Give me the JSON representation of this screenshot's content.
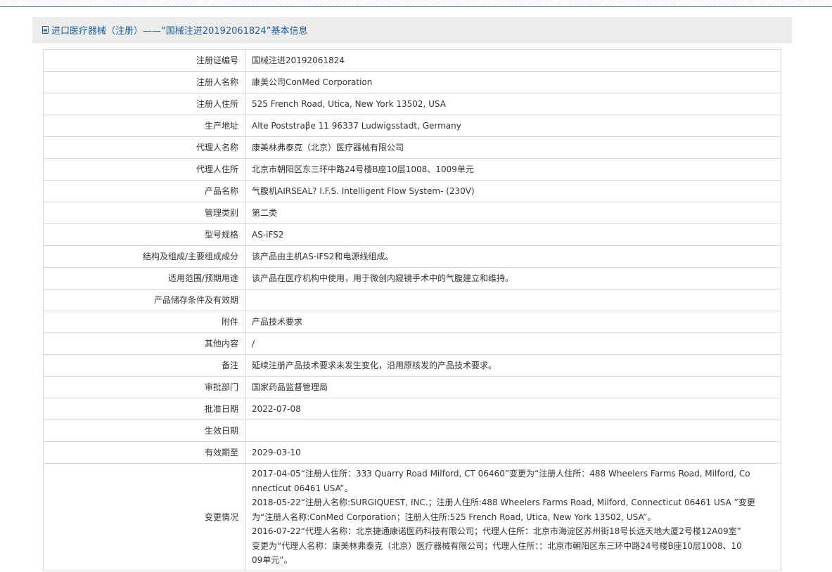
{
  "header": {
    "title": "进口医疗器械（注册）——“国械注进20192061824”基本信息"
  },
  "rows": [
    {
      "label": "注册证编号",
      "value": "国械注进20192061824"
    },
    {
      "label": "注册人名称",
      "value": "康美公司ConMed Corporation"
    },
    {
      "label": "注册人住所",
      "value": "525 French Road, Utica, New York 13502, USA"
    },
    {
      "label": "生产地址",
      "value": "Alte Poststraβe 11 96337 Ludwigsstadt, Germany"
    },
    {
      "label": "代理人名称",
      "value": "康美林弗泰克（北京）医疗器械有限公司"
    },
    {
      "label": "代理人住所",
      "value": "北京市朝阳区东三环中路24号楼B座10层1008、1009单元"
    },
    {
      "label": "产品名称",
      "value": "气腹机AIRSEAL? I.F.S. Intelligent Flow System- (230V)"
    },
    {
      "label": "管理类别",
      "value": "第二类"
    },
    {
      "label": "型号规格",
      "value": "AS-iFS2"
    },
    {
      "label": "结构及组成/主要组成成分",
      "value": "该产品由主机AS-iFS2和电源线组成。"
    },
    {
      "label": "适用范围/预期用途",
      "value": "该产品在医疗机构中使用，用于微创内窥镜手术中的气腹建立和维持。"
    },
    {
      "label": "产品储存条件及有效期",
      "value": ""
    },
    {
      "label": "附件",
      "value": "产品技术要求"
    },
    {
      "label": "其他内容",
      "value": "/"
    },
    {
      "label": "备注",
      "value": "延续注册产品技术要求未发生变化，沿用原核发的产品技术要求。"
    },
    {
      "label": "审批部门",
      "value": "国家药品监督管理局"
    },
    {
      "label": "批准日期",
      "value": "2022-07-08"
    },
    {
      "label": "生效日期",
      "value": ""
    },
    {
      "label": "有效期至",
      "value": "2029-03-10"
    }
  ],
  "change": {
    "label": "变更情况",
    "lines": [
      "2017-04-05“注册人住所：333 Quarry Road Milford, CT 06460”变更为“注册人住所：488 Wheelers Farms Road, Milford, Co",
      "nnecticut 06461 USA”。",
      "2018-05-22“注册人名称:SURGIQUEST, INC.；注册人住所:488 Wheelers Farms Road, Milford, Connecticut 06461 USA ”变更",
      "为“注册人名称:ConMed Corporation；注册人住所:525 French Road, Utica, New York 13502, USA”。",
      "2016-07-22“代理人名称：北京捷通康诺医药科技有限公司；代理人住所：北京市海淀区苏州街18号长远天地大厦2号楼12A09室”",
      "变更为“代理人名称：康美林弗泰克（北京）医疗器械有限公司；代理人住所：：北京市朝阳区东三环中路24号楼B座10层1008、10",
      "09单元”。"
    ]
  }
}
